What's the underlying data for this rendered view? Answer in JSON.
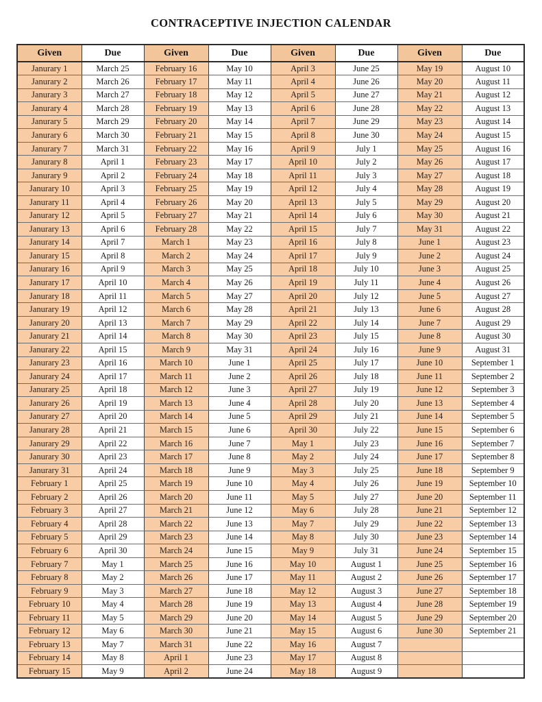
{
  "document": {
    "title": "CONTRACEPTIVE INJECTION CALENDAR"
  },
  "table": {
    "column_groups": 4,
    "headers": [
      "Given",
      "Due",
      "Given",
      "Due",
      "Given",
      "Due",
      "Given",
      "Due"
    ],
    "colors": {
      "given_cell_background": "#f8cda6",
      "given_header_background": "#f3c59b",
      "due_cell_background": "#ffffff",
      "border": "#2b2b2b",
      "text": "#1a1a1a"
    },
    "row_count": 46,
    "rows": [
      [
        "Janurary 1",
        "March 25",
        "February 16",
        "May 10",
        "April 3",
        "June 25",
        "May 19",
        "August 10"
      ],
      [
        "Janurary 2",
        "March 26",
        "February 17",
        "May 11",
        "April 4",
        "June 26",
        "May 20",
        "August 11"
      ],
      [
        "Janurary 3",
        "March 27",
        "February 18",
        "May 12",
        "April 5",
        "June 27",
        "May 21",
        "August 12"
      ],
      [
        "Janurary 4",
        "March 28",
        "February 19",
        "May 13",
        "April 6",
        "June 28",
        "May 22",
        "August 13"
      ],
      [
        "Janurary 5",
        "March 29",
        "February 20",
        "May 14",
        "April 7",
        "June 29",
        "May 23",
        "August 14"
      ],
      [
        "Janurary 6",
        "March 30",
        "February 21",
        "May 15",
        "April 8",
        "June 30",
        "May 24",
        "August 15"
      ],
      [
        "Janurary 7",
        "March 31",
        "February 22",
        "May 16",
        "April 9",
        "July 1",
        "May 25",
        "August 16"
      ],
      [
        "Janurary 8",
        "April 1",
        "February 23",
        "May 17",
        "April 10",
        "July 2",
        "May 26",
        "August 17"
      ],
      [
        "Janurary 9",
        "April 2",
        "February 24",
        "May 18",
        "April 11",
        "July 3",
        "May 27",
        "August 18"
      ],
      [
        "Janurary 10",
        "April 3",
        "February 25",
        "May 19",
        "April 12",
        "July 4",
        "May 28",
        "August 19"
      ],
      [
        "Janurary 11",
        "April 4",
        "February 26",
        "May 20",
        "April 13",
        "July 5",
        "May 29",
        "August 20"
      ],
      [
        "Janurary 12",
        "April 5",
        "February 27",
        "May 21",
        "April 14",
        "July 6",
        "May 30",
        "August 21"
      ],
      [
        "Janurary 13",
        "April 6",
        "February 28",
        "May 22",
        "April 15",
        "July 7",
        "May 31",
        "August 22"
      ],
      [
        "Janurary 14",
        "April 7",
        "March 1",
        "May 23",
        "April 16",
        "July 8",
        "June 1",
        "August 23"
      ],
      [
        "Janurary 15",
        "April 8",
        "March 2",
        "May 24",
        "April 17",
        "July 9",
        "June 2",
        "August 24"
      ],
      [
        "Janurary 16",
        "April 9",
        "March 3",
        "May 25",
        "April 18",
        "July 10",
        "June 3",
        "August 25"
      ],
      [
        "Janurary 17",
        "April 10",
        "March 4",
        "May 26",
        "April 19",
        "July 11",
        "June 4",
        "August 26"
      ],
      [
        "Janurary 18",
        "April 11",
        "March 5",
        "May 27",
        "April 20",
        "July 12",
        "June 5",
        "August 27"
      ],
      [
        "Janurary 19",
        "April 12",
        "March 6",
        "May 28",
        "April 21",
        "July 13",
        "June 6",
        "August 28"
      ],
      [
        "Janurary 20",
        "April 13",
        "March 7",
        "May 29",
        "April 22",
        "July 14",
        "June 7",
        "August 29"
      ],
      [
        "Janurary 21",
        "April 14",
        "March 8",
        "May 30",
        "April 23",
        "July 15",
        "June 8",
        "August 30"
      ],
      [
        "Janurary 22",
        "April 15",
        "March 9",
        "May 31",
        "April 24",
        "July 16",
        "June 9",
        "August 31"
      ],
      [
        "Janurary 23",
        "April 16",
        "March 10",
        "June 1",
        "April 25",
        "July 17",
        "June 10",
        "September 1"
      ],
      [
        "Janurary 24",
        "April 17",
        "March 11",
        "June 2",
        "April 26",
        "July 18",
        "June 11",
        "September 2"
      ],
      [
        "Janurary 25",
        "April 18",
        "March 12",
        "June 3",
        "April 27",
        "July 19",
        "June 12",
        "September 3"
      ],
      [
        "Janurary 26",
        "April 19",
        "March 13",
        "June 4",
        "April 28",
        "July 20",
        "June 13",
        "September 4"
      ],
      [
        "Janurary 27",
        "April 20",
        "March 14",
        "June 5",
        "April 29",
        "July 21",
        "June 14",
        "September 5"
      ],
      [
        "Janurary 28",
        "April 21",
        "March 15",
        "June 6",
        "April 30",
        "July 22",
        "June 15",
        "September 6"
      ],
      [
        "Janurary 29",
        "April 22",
        "March 16",
        "June 7",
        "May 1",
        "July 23",
        "June 16",
        "September 7"
      ],
      [
        "Janurary 30",
        "April 23",
        "March 17",
        "June 8",
        "May 2",
        "July 24",
        "June 17",
        "September 8"
      ],
      [
        "Janurary 31",
        "April 24",
        "March 18",
        "June 9",
        "May 3",
        "July 25",
        "June 18",
        "September 9"
      ],
      [
        "February 1",
        "April 25",
        "March 19",
        "June 10",
        "May 4",
        "July 26",
        "June 19",
        "September 10"
      ],
      [
        "February 2",
        "April 26",
        "March 20",
        "June 11",
        "May 5",
        "July 27",
        "June 20",
        "September 11"
      ],
      [
        "February 3",
        "April 27",
        "March 21",
        "June 12",
        "May 6",
        "July 28",
        "June 21",
        "September 12"
      ],
      [
        "February 4",
        "April 28",
        "March 22",
        "June 13",
        "May 7",
        "July 29",
        "June 22",
        "September 13"
      ],
      [
        "February 5",
        "April 29",
        "March 23",
        "June 14",
        "May 8",
        "July 30",
        "June 23",
        "September 14"
      ],
      [
        "February 6",
        "April 30",
        "March 24",
        "June 15",
        "May 9",
        "July 31",
        "June 24",
        "September 15"
      ],
      [
        "February 7",
        "May 1",
        "March 25",
        "June 16",
        "May 10",
        "August 1",
        "June 25",
        "September 16"
      ],
      [
        "February 8",
        "May 2",
        "March 26",
        "June 17",
        "May 11",
        "August 2",
        "June 26",
        "September 17"
      ],
      [
        "February 9",
        "May 3",
        "March 27",
        "June 18",
        "May 12",
        "August 3",
        "June 27",
        "September 18"
      ],
      [
        "February 10",
        "May 4",
        "March 28",
        "June 19",
        "May 13",
        "August 4",
        "June 28",
        "September 19"
      ],
      [
        "February 11",
        "May 5",
        "March 29",
        "June 20",
        "May 14",
        "August 5",
        "June 29",
        "September 20"
      ],
      [
        "February 12",
        "May 6",
        "March 30",
        "June 21",
        "May 15",
        "August 6",
        "June 30",
        "September 21"
      ],
      [
        "February 13",
        "May 7",
        "March 31",
        "June 22",
        "May 16",
        "August 7",
        "",
        ""
      ],
      [
        "February 14",
        "May 8",
        "April 1",
        "June 23",
        "May 17",
        "August 8",
        "",
        ""
      ],
      [
        "February 15",
        "May 9",
        "April 2",
        "June 24",
        "May 18",
        "August 9",
        "",
        ""
      ]
    ]
  }
}
